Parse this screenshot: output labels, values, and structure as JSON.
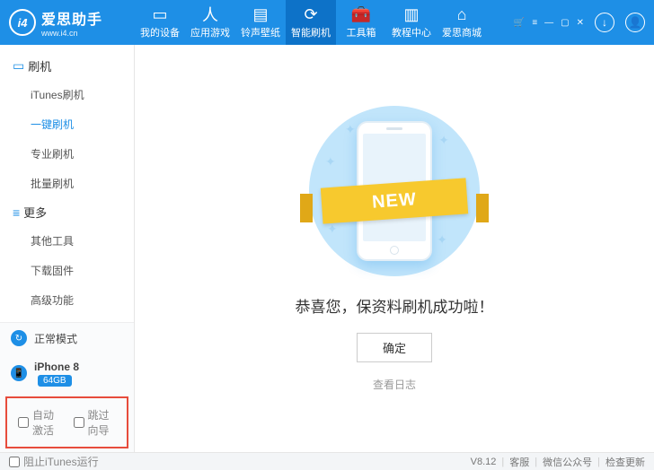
{
  "header": {
    "brand": "爱思助手",
    "url": "www.i4.cn",
    "logo_glyph": "i4",
    "tabs": [
      {
        "label": "我的设备",
        "icon": "▭"
      },
      {
        "label": "应用游戏",
        "icon": "人"
      },
      {
        "label": "铃声壁纸",
        "icon": "▤"
      },
      {
        "label": "智能刷机",
        "icon": "⟳"
      },
      {
        "label": "工具箱",
        "icon": "🧰"
      },
      {
        "label": "教程中心",
        "icon": "▥"
      },
      {
        "label": "爱思商城",
        "icon": "⌂"
      }
    ],
    "active_tab_index": 3,
    "window_icons": {
      "cart": "🛒",
      "menu": "≡",
      "min": "—",
      "max": "▢",
      "close": "✕",
      "download": "↓",
      "profile": "👤"
    }
  },
  "sidebar": {
    "groups": [
      {
        "label": "刷机",
        "icon": "▭",
        "items": [
          "iTunes刷机",
          "一键刷机",
          "专业刷机",
          "批量刷机"
        ],
        "active": 1
      },
      {
        "label": "更多",
        "icon": "≡",
        "items": [
          "其他工具",
          "下载固件",
          "高级功能"
        ],
        "active": -1
      }
    ],
    "status": {
      "icon": "↻",
      "label": "正常模式"
    },
    "device": {
      "icon": "📱",
      "name": "iPhone 8",
      "storage": "64GB"
    },
    "options": [
      {
        "label": "自动激活"
      },
      {
        "label": "跳过向导"
      }
    ]
  },
  "content": {
    "ribbon": "NEW",
    "message": "恭喜您，保资料刷机成功啦！",
    "ok": "确定",
    "log": "查看日志"
  },
  "footer": {
    "block_itunes": "阻止iTunes运行",
    "version": "V8.12",
    "links": [
      "客服",
      "微信公众号",
      "检查更新"
    ]
  }
}
